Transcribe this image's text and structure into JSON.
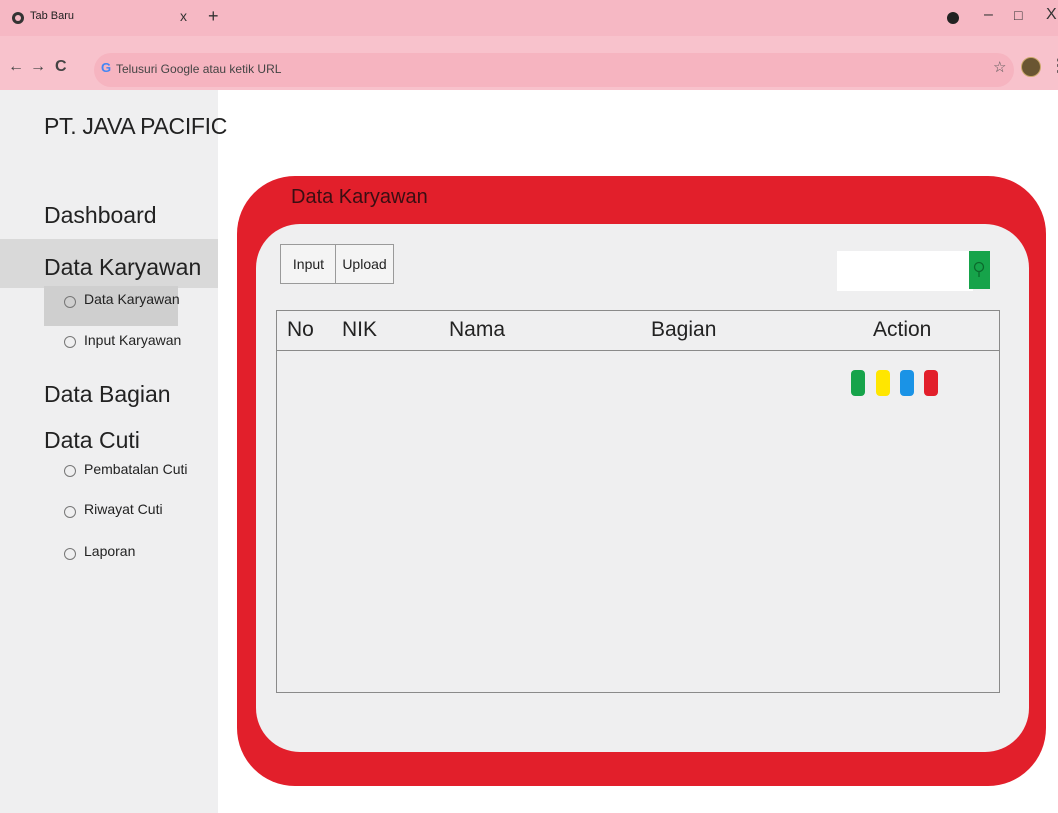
{
  "browser": {
    "tab_title": "Tab Baru",
    "tab_close": "x",
    "new_tab": "+",
    "omnibox_placeholder": "Telusuri Google atau ketik URL",
    "google_glyph": "G",
    "window_min": "–",
    "window_max": "□",
    "window_close": "X",
    "nav_back": "←",
    "nav_forward": "→",
    "nav_reload": "C",
    "star": "☆",
    "menu": "⋮"
  },
  "sidebar": {
    "brand": "PT. JAVA PACIFIC",
    "items": [
      {
        "label": "Dashboard"
      },
      {
        "label": "Data Karyawan",
        "selected": true
      },
      {
        "label": "Data Bagian"
      },
      {
        "label": "Data Cuti"
      }
    ],
    "sub_karyawan": [
      {
        "label": "Data Karyawan",
        "selected": true
      },
      {
        "label": "Input Karyawan"
      }
    ],
    "sub_cuti": [
      {
        "label": "Pembatalan Cuti"
      },
      {
        "label": "Riwayat Cuti"
      },
      {
        "label": "Laporan"
      }
    ]
  },
  "main": {
    "title": "Data Karyawan",
    "buttons": {
      "input": "Input",
      "upload": "Upload"
    },
    "search": {
      "placeholder": "",
      "icon": "search-icon"
    },
    "table": {
      "columns": [
        "No",
        "NIK",
        "Nama",
        "Bagian",
        "Action"
      ],
      "action_chips": [
        {
          "name": "green-action",
          "color": "#16a34a"
        },
        {
          "name": "yellow-action",
          "color": "#ffe600"
        },
        {
          "name": "blue-action",
          "color": "#1a93e6"
        },
        {
          "name": "red-action",
          "color": "#e21f2b"
        }
      ]
    }
  },
  "colors": {
    "chrome_pink": "#f6b8c4",
    "panel_red": "#e21f2b",
    "sidebar_grey": "#efeff0",
    "search_green": "#16a34a"
  }
}
